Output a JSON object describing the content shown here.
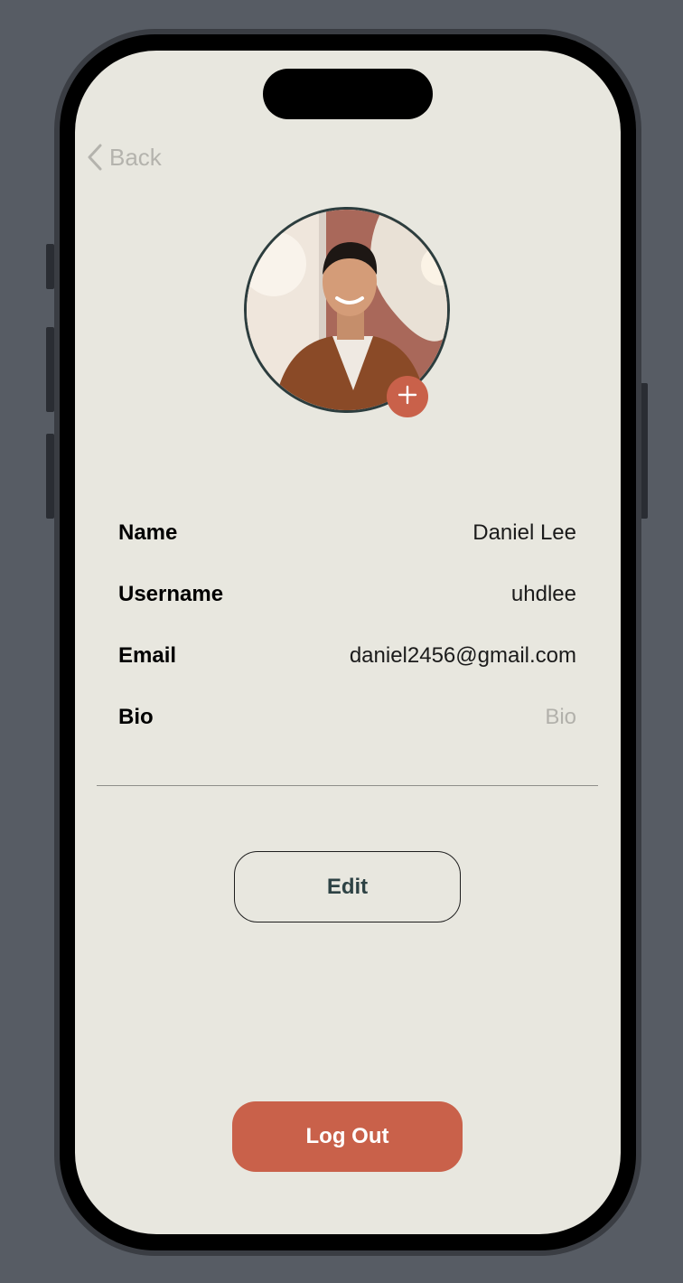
{
  "nav": {
    "back_label": "Back"
  },
  "profile": {
    "fields": [
      {
        "label": "Name",
        "value": "Daniel Lee"
      },
      {
        "label": "Username",
        "value": "uhdlee"
      },
      {
        "label": "Email",
        "value": "daniel2456@gmail.com"
      },
      {
        "label": "Bio",
        "placeholder": "Bio"
      }
    ]
  },
  "actions": {
    "edit_label": "Edit",
    "logout_label": "Log Out"
  },
  "icons": {
    "back": "chevron-left-icon",
    "add_photo": "plus-icon"
  },
  "colors": {
    "background": "#e8e7df",
    "accent": "#c9614a",
    "button_text": "#2d4244",
    "placeholder": "#b2b1ab"
  }
}
